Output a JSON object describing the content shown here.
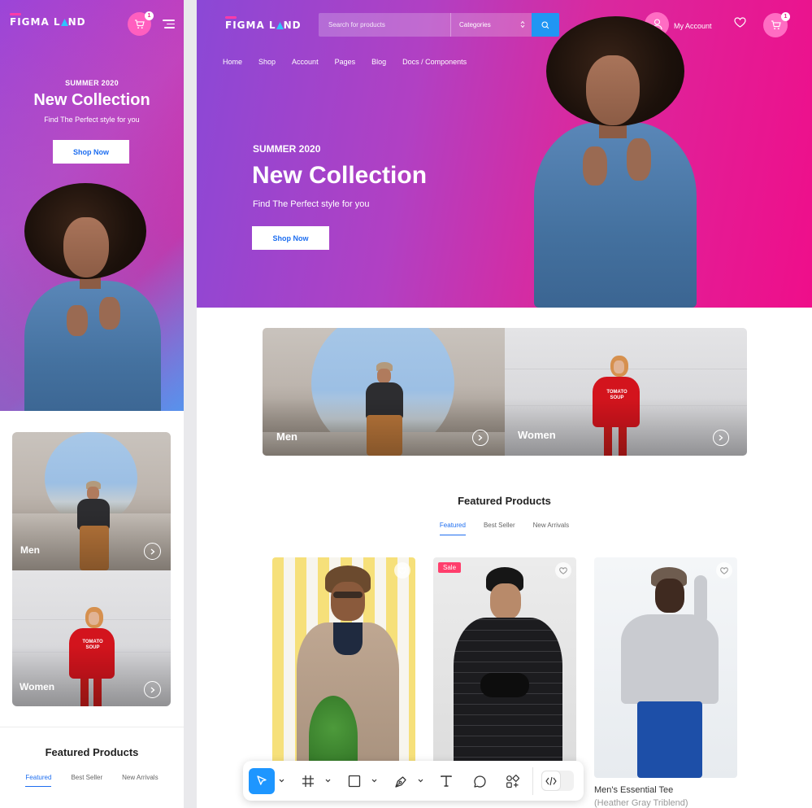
{
  "brand": {
    "name_part1": "FIGMA L",
    "name_part2": "ND"
  },
  "mobile": {
    "cart_count": "1",
    "hero": {
      "season": "SUMMER 2020",
      "title": "New Collection",
      "subtitle": "Find The Perfect style for you",
      "cta": "Shop Now"
    },
    "categories": [
      {
        "label": "Men"
      },
      {
        "label": "Women"
      }
    ],
    "featured": {
      "title": "Featured Products",
      "tabs": [
        "Featured",
        "Best Seller",
        "New Arrivals"
      ],
      "active_tab": "Featured"
    }
  },
  "desktop": {
    "search": {
      "placeholder": "Search for products",
      "category": "Categories"
    },
    "account_label": "My Account",
    "cart_count": "1",
    "nav": [
      "Home",
      "Shop",
      "Account",
      "Pages",
      "Blog",
      "Docs / Components"
    ],
    "hero": {
      "season": "SUMMER 2020",
      "title": "New Collection",
      "subtitle": "Find The Perfect style for you",
      "cta": "Shop Now"
    },
    "categories": [
      {
        "label": "Men"
      },
      {
        "label": "Women"
      }
    ],
    "featured": {
      "title": "Featured Products",
      "tabs": [
        "Featured",
        "Best Seller",
        "New Arrivals"
      ],
      "active_tab": "Featured"
    },
    "products": [
      {
        "badge": ""
      },
      {
        "badge": "Sale"
      },
      {
        "badge": "",
        "name": "Men's Essential Tee",
        "variant": "(Heather Gray Triblend)"
      }
    ]
  },
  "toolbar": {
    "tools": [
      "move-tool-icon",
      "frame-tool-icon",
      "rectangle-tool-icon",
      "pen-tool-icon",
      "text-tool-icon",
      "comment-tool-icon",
      "components-icon",
      "code-view-icon"
    ],
    "active_tool": "move-tool-icon"
  },
  "colors": {
    "accent": "#1e6ef0",
    "pink": "#ec1187",
    "purple": "#8b48d6",
    "sale": "#ff3e6c",
    "toolbar_active": "#1e96ff"
  }
}
